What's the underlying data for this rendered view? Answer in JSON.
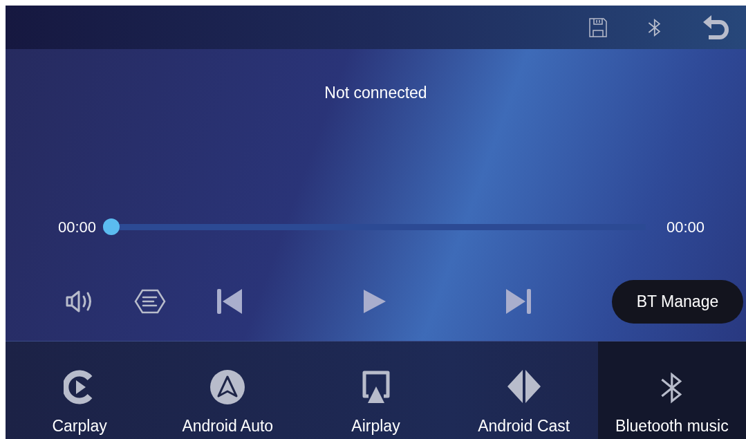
{
  "status": "Not connected",
  "progress": {
    "elapsed": "00:00",
    "total": "00:00",
    "level": 0
  },
  "bt_manage": "BT Manage",
  "tabs": [
    {
      "kind": "carplay",
      "label": "Carplay",
      "selected": false
    },
    {
      "kind": "android_auto",
      "label": "Android Auto",
      "selected": false
    },
    {
      "kind": "airplay",
      "label": "Airplay",
      "selected": false
    },
    {
      "kind": "android_cast",
      "label": "Android Cast",
      "selected": false
    },
    {
      "kind": "bluetooth",
      "label": "Bluetooth music",
      "selected": true
    }
  ]
}
